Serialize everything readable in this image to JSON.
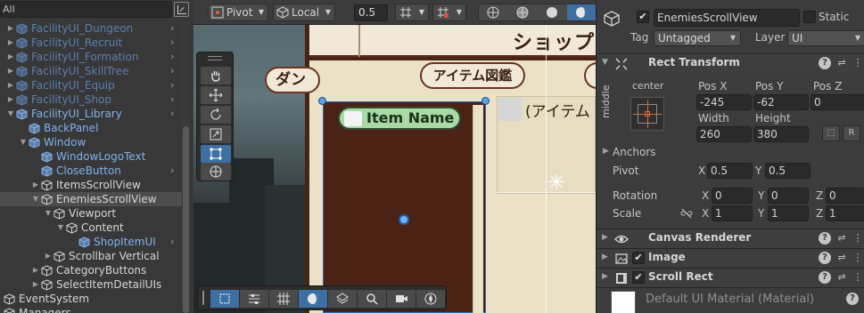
{
  "hierarchy": {
    "search_value": "All",
    "items": [
      {
        "label": "FacilityUI_Dungeon",
        "style": "dim"
      },
      {
        "label": "FacilityUI_Recruit",
        "style": "dim"
      },
      {
        "label": "FacilityUI_Formation",
        "style": "dim"
      },
      {
        "label": "FacilityUI_SkillTree",
        "style": "dim"
      },
      {
        "label": "FacilityUI_Equip",
        "style": "dim"
      },
      {
        "label": "FacilityUI_Shop",
        "style": "dim"
      },
      {
        "label": "FacilityUI_Library",
        "style": "blue"
      },
      {
        "label": "BackPanel",
        "style": "blue"
      },
      {
        "label": "Window",
        "style": "blue"
      },
      {
        "label": "WindowLogoText",
        "style": "blue"
      },
      {
        "label": "CloseButton",
        "style": "blue"
      },
      {
        "label": "ItemsScrollView",
        "style": "white"
      },
      {
        "label": "EnemiesScrollView",
        "style": "white"
      },
      {
        "label": "Viewport",
        "style": "white"
      },
      {
        "label": "Content",
        "style": "white"
      },
      {
        "label": "ShopItemUI",
        "style": "blue"
      },
      {
        "label": "Scrollbar Vertical",
        "style": "white"
      },
      {
        "label": "CategoryButtons",
        "style": "white"
      },
      {
        "label": "SelectItemDetailUIs",
        "style": "white"
      },
      {
        "label": "EventSystem",
        "style": "white"
      },
      {
        "label": "Managers",
        "style": "white"
      }
    ]
  },
  "scene": {
    "toolbar": {
      "pivot_label": "Pivot",
      "space_label": "Local",
      "snap_value": "0.5"
    },
    "game_ui": {
      "shop_title": "ショップ",
      "tab_daily": "ダン",
      "tab_catalog": "アイテム図鑑",
      "item_name": "Item Name",
      "detail_text": "(アイテム"
    }
  },
  "inspector": {
    "object_name": "EnemiesScrollView",
    "active": true,
    "static_label": "Static",
    "tag_label": "Tag",
    "tag_value": "Untagged",
    "layer_label": "Layer",
    "layer_value": "UI",
    "rect_transform": {
      "title": "Rect Transform",
      "anchor_h": "center",
      "anchor_v": "middle",
      "pos_x_label": "Pos X",
      "pos_y_label": "Pos Y",
      "pos_z_label": "Pos Z",
      "pos_x": "-245",
      "pos_y": "-62",
      "pos_z": "0",
      "width_label": "Width",
      "height_label": "Height",
      "width": "260",
      "height": "380",
      "raw_btn": "R",
      "anchors_label": "Anchors",
      "pivot_label": "Pivot",
      "pivot_x": "0.5",
      "pivot_y": "0.5",
      "rotation_label": "Rotation",
      "rot_x": "0",
      "rot_y": "0",
      "rot_z": "0",
      "scale_label": "Scale",
      "scale_x": "1",
      "scale_y": "1",
      "scale_z": "1",
      "x_label": "X",
      "y_label": "Y",
      "z_label": "Z"
    },
    "components": [
      {
        "name": "Canvas Renderer"
      },
      {
        "name": "Image"
      },
      {
        "name": "Scroll Rect"
      }
    ],
    "material_label": "Default UI Material (Material)"
  },
  "colors": {
    "accent": "#3d6fa3",
    "prefab_blue": "#7fb1ef",
    "item_pill": "#a9d9a5"
  }
}
